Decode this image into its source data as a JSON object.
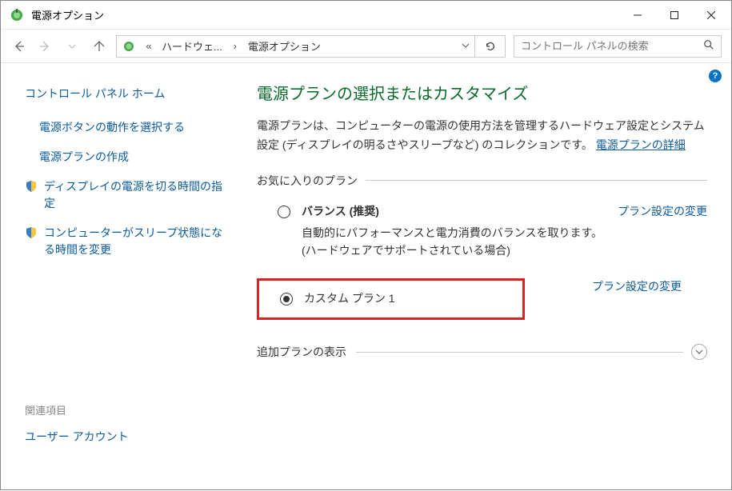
{
  "window": {
    "title": "電源オプション"
  },
  "nav": {
    "breadcrumb": {
      "dbl_chev": "«",
      "item1": "ハードウェ...",
      "chev": "›",
      "item2": "電源オプション"
    },
    "search_placeholder": "コントロール パネルの検索"
  },
  "sidebar": {
    "home": "コントロール パネル ホーム",
    "items": [
      "電源ボタンの動作を選択する",
      "電源プランの作成",
      "ディスプレイの電源を切る時間の指定",
      "コンピューターがスリープ状態になる時間を変更"
    ],
    "related_head": "関連項目",
    "related_item": "ユーザー アカウント"
  },
  "main": {
    "heading": "電源プランの選択またはカスタマイズ",
    "desc_before": "電源プランは、コンピューターの電源の使用方法を管理するハードウェア設定とシステム設定 (ディスプレイの明るさやスリープなど) のコレクションです。",
    "desc_link": "電源プランの詳細",
    "fav_label": "お気に入りのプラン",
    "plans": [
      {
        "name": "バランス (推奨)",
        "desc": "自動的にパフォーマンスと電力消費のバランスを取ります。(ハードウェアでサポートされている場合)",
        "change": "プラン設定の変更"
      },
      {
        "name": "カスタム プラン 1",
        "change": "プラン設定の変更"
      }
    ],
    "expand_label": "追加プランの表示"
  },
  "help_badge": "?"
}
